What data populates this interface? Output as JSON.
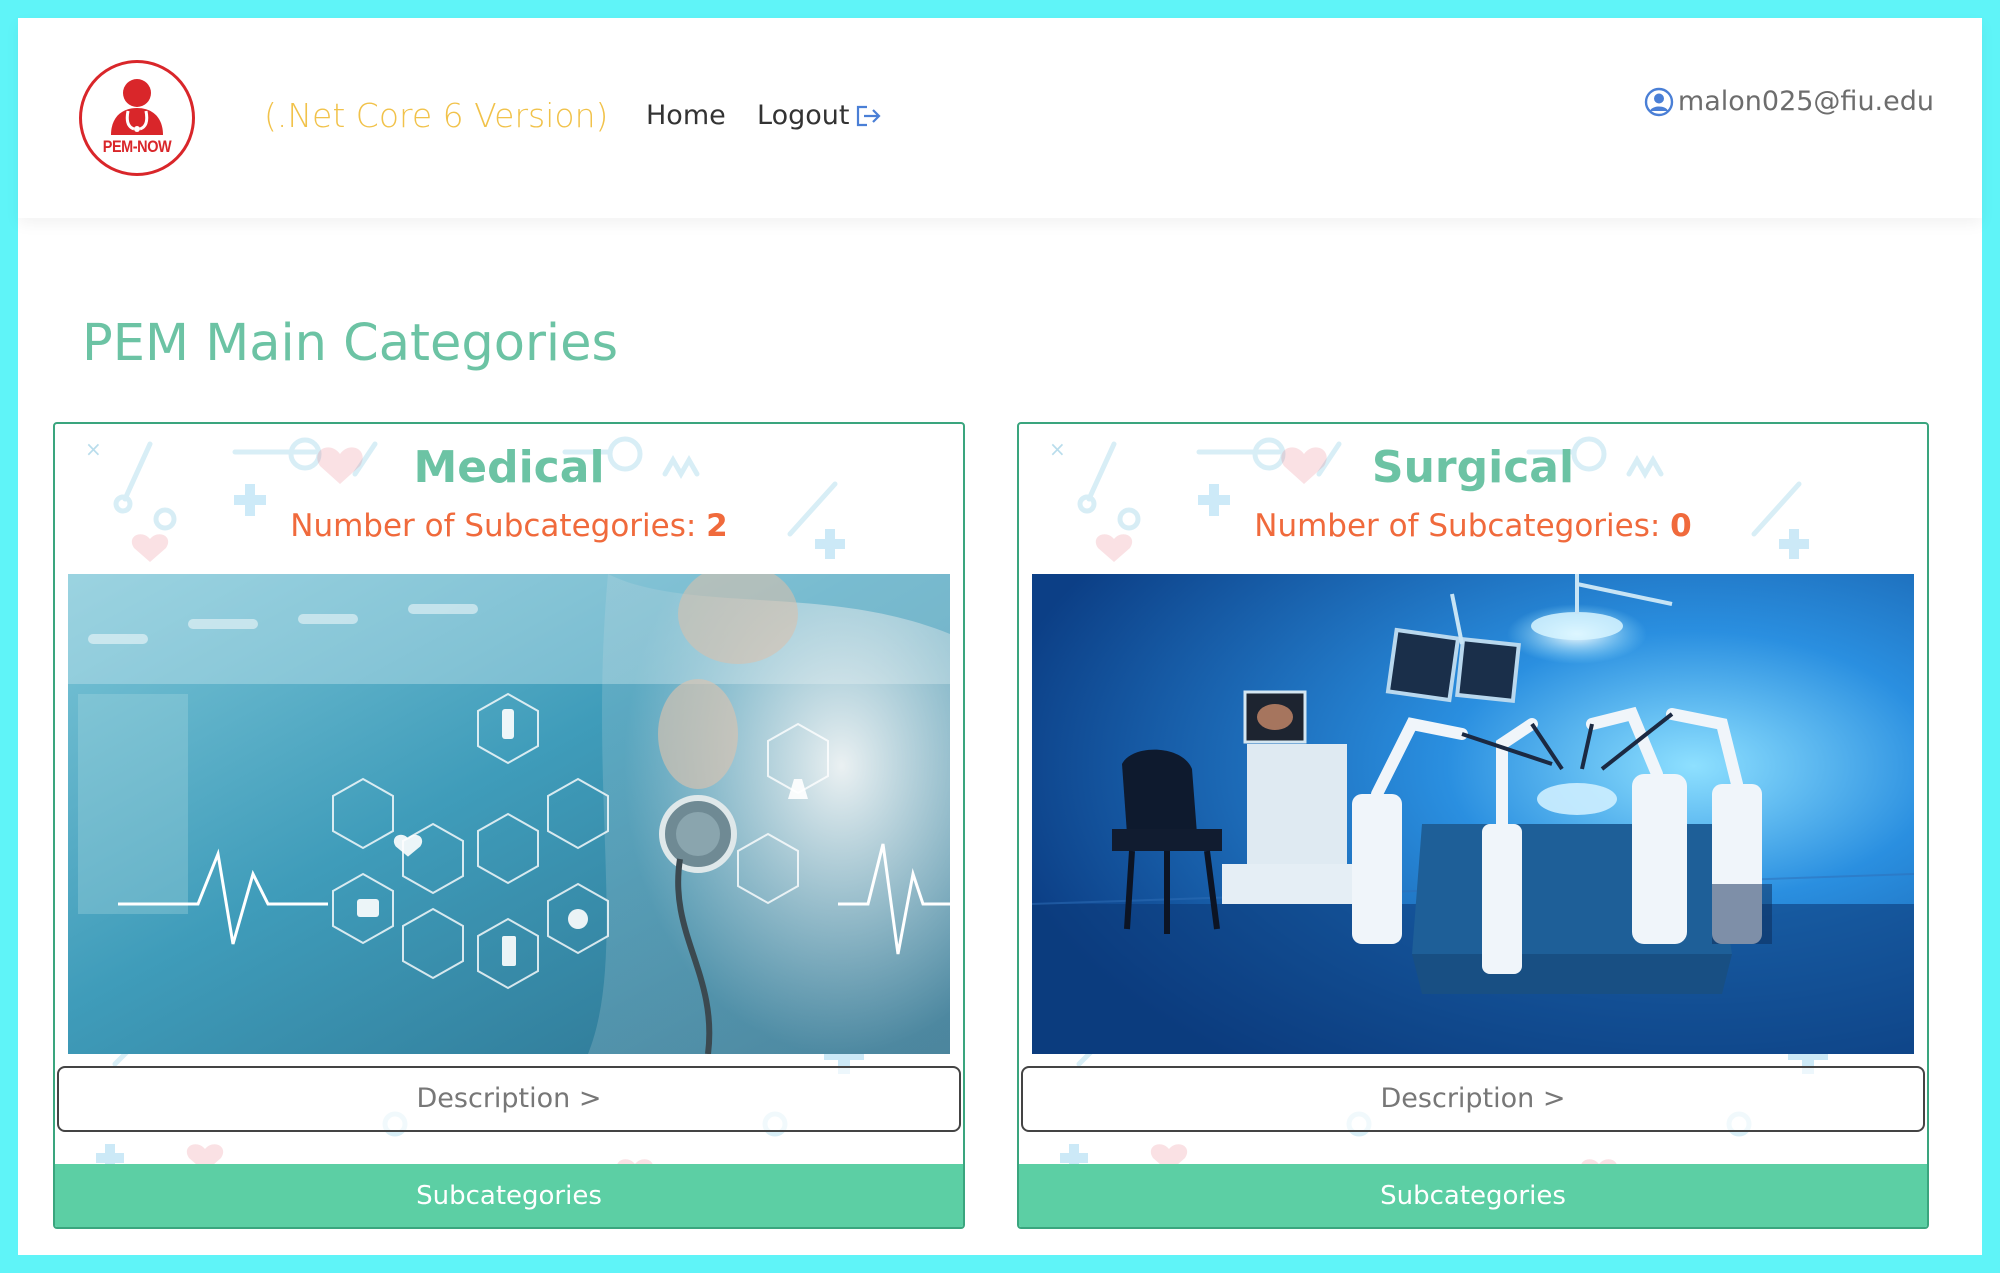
{
  "header": {
    "logo_text": "PEM-NOW",
    "version": "(.Net Core 6 Version)",
    "nav": {
      "home": "Home",
      "logout": "Logout"
    },
    "user_email": "malon025@fiu.edu"
  },
  "main": {
    "title": "PEM Main Categories",
    "cards": [
      {
        "title": "Medical",
        "count_label": "Number of Subcategories:",
        "count": "2",
        "description_label": "Description >",
        "subcategories_label": "Subcategories"
      },
      {
        "title": "Surgical",
        "count_label": "Number of Subcategories:",
        "count": "0",
        "description_label": "Description >",
        "subcategories_label": "Subcategories"
      }
    ]
  },
  "colors": {
    "frame": "#5ff4f8",
    "accent_green": "#6cc3a4",
    "button_green": "#5ccfa4",
    "count_orange": "#f06a3c",
    "version_yellow": "#f1c24a",
    "logo_red": "#d9262a"
  },
  "icons": [
    "user-circle-icon",
    "logout-icon",
    "doctor-logo-icon"
  ]
}
